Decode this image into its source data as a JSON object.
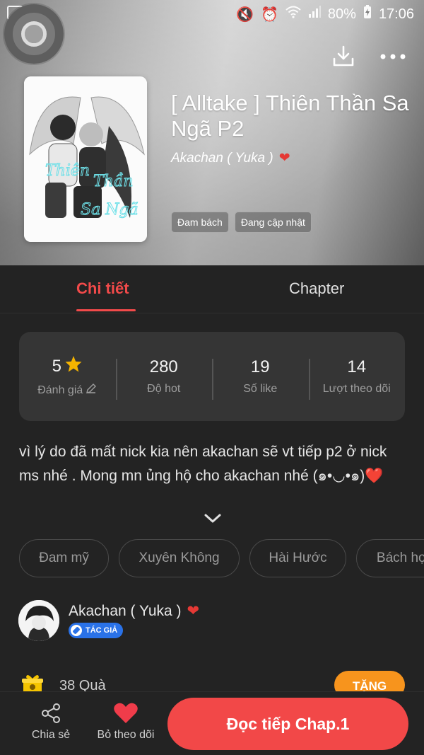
{
  "status_bar": {
    "battery": "80%",
    "time": "17:06"
  },
  "novel": {
    "title": "[ Alltake ] Thiên Thần Sa Ngã P2",
    "author": "Akachan ( Yuka )",
    "author_emoji": "❤",
    "genre_tags": [
      "Đam bách",
      "Đang cập nhật"
    ],
    "cover_text": [
      "Thiên",
      "Thần",
      "Sa Ngã"
    ]
  },
  "tabs": [
    "Chi tiết",
    "Chapter"
  ],
  "stats": [
    {
      "value": "5",
      "label": "Đánh giá",
      "icon": "star-icon"
    },
    {
      "value": "280",
      "label": "Độ hot"
    },
    {
      "value": "19",
      "label": "Số like"
    },
    {
      "value": "14",
      "label": "Lượt theo dõi"
    }
  ],
  "description": "vì lý do đã mất nick kia nên akachan sẽ vt tiếp p2 ở nick ms nhé . Mong mn ủng hộ cho akachan nhé (๑•◡•๑)❤️",
  "categories": [
    "Đam mỹ",
    "Xuyên Không",
    "Hài Hước",
    "Bách hợp"
  ],
  "author_section": {
    "name": "Akachan ( Yuka )",
    "emoji": "❤",
    "badge": "TÁC GIẢ"
  },
  "gifts": {
    "count_label": "38 Quà",
    "give_button": "TẶNG"
  },
  "bottom_bar": {
    "share": "Chia sẻ",
    "unfollow": "Bỏ theo dõi",
    "read": "Đọc tiếp Chap.1"
  },
  "colors": {
    "accent": "#f24a4a",
    "orange": "#f7941d",
    "background": "#232323",
    "badge_blue": "#2a72e8"
  }
}
